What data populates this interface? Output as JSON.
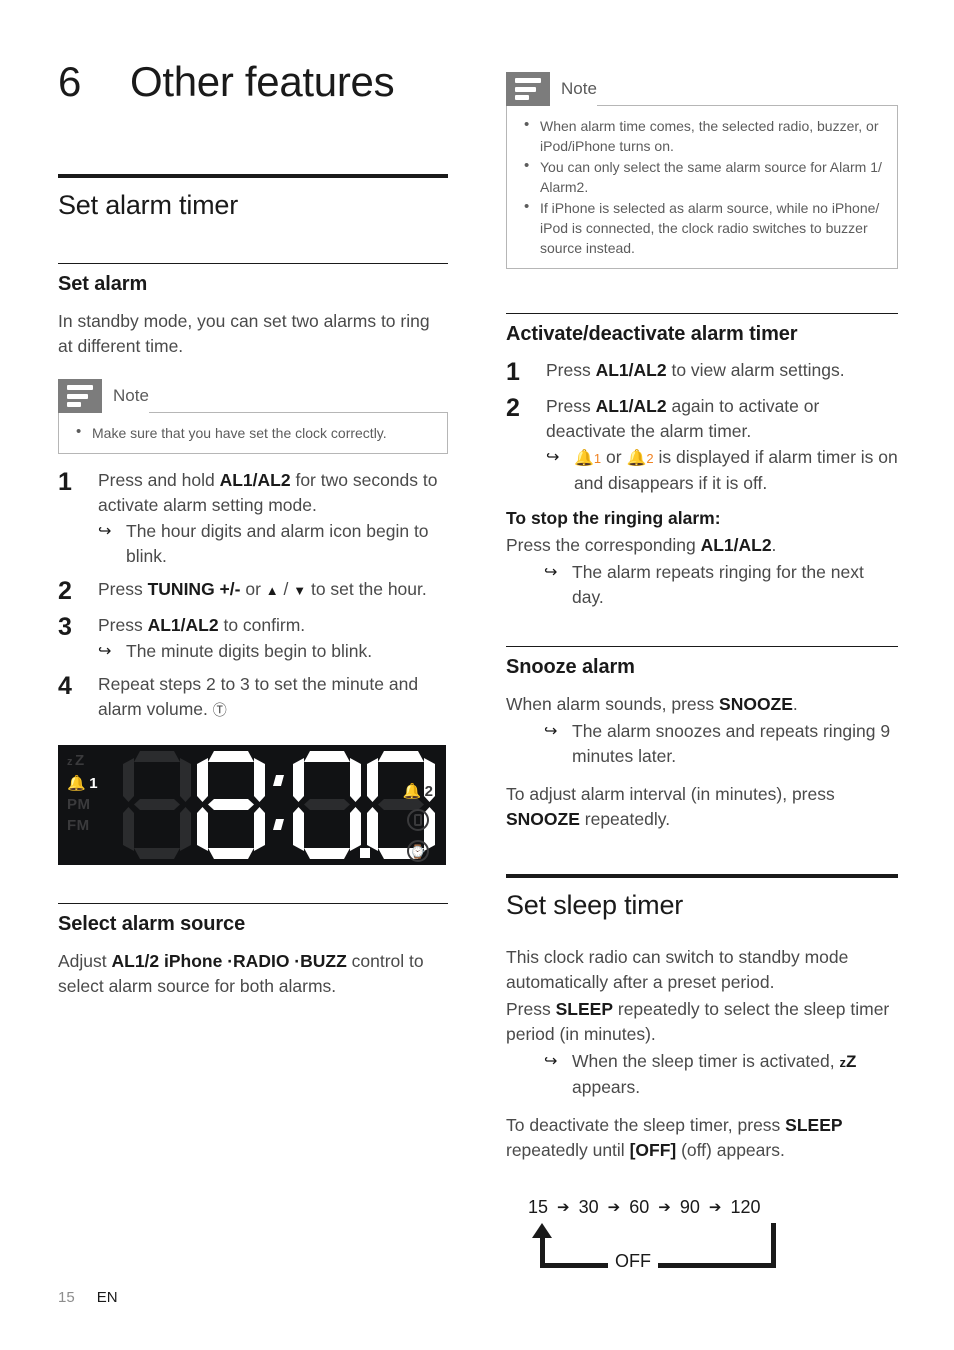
{
  "chapter": {
    "number": "6",
    "title": "Other features"
  },
  "footer": {
    "page": "15",
    "language": "EN"
  },
  "left": {
    "section_title": "Set alarm timer",
    "set_alarm": {
      "heading": "Set alarm",
      "intro": "In standby mode, you can set two alarms to ring at different time.",
      "note": {
        "label": "Note",
        "items": [
          "Make sure that you have set the clock correctly."
        ]
      },
      "steps": [
        {
          "num": "1",
          "text_before": "Press and hold ",
          "bold": "AL1/AL2",
          "text_after": " for two seconds to activate alarm setting mode.",
          "result": "The hour digits and alarm icon begin to blink."
        },
        {
          "num": "2",
          "text_before": "Press ",
          "bold": "TUNING +/-",
          "text_mid": " or ",
          "text_after": " to set the hour.",
          "result": ""
        },
        {
          "num": "3",
          "text_before": "Press ",
          "bold": "AL1/AL2",
          "text_after": " to confirm.",
          "result": "The minute digits begin to blink."
        },
        {
          "num": "4",
          "text_before": "Repeat steps 2 to 3 to set the minute and alarm volume. ",
          "bold": "",
          "text_after": "",
          "result": ""
        }
      ]
    },
    "lcd": {
      "indicators_left": [
        "zZ",
        "1",
        "PM",
        "FM"
      ],
      "indicators_right": [
        "2",
        "ipod-icon",
        "buzzer-icon"
      ],
      "digits": [
        "8",
        "8",
        "0",
        "0"
      ],
      "active_left_indicator": "alarm-1"
    },
    "select_source": {
      "heading": "Select alarm source",
      "text_before": "Adjust ",
      "bold": "AL1/2 iPhone ·RADIO ·BUZZ",
      "text_after": " control to select alarm source for both alarms."
    }
  },
  "right": {
    "note": {
      "label": "Note",
      "items": [
        "When alarm time comes, the selected radio, buzzer, or iPod/iPhone turns on.",
        "You can only select the same alarm source for Alarm 1/ Alarm2.",
        "If iPhone is selected as alarm source, while no iPhone/ iPod is connected, the clock radio switches to buzzer source instead."
      ]
    },
    "activate": {
      "heading": "Activate/deactivate alarm timer",
      "steps": [
        {
          "num": "1",
          "text_before": "Press ",
          "bold": "AL1/AL2",
          "text_after": " to view alarm settings.",
          "result": ""
        },
        {
          "num": "2",
          "text_before": "Press ",
          "bold": "AL1/AL2",
          "text_after": " again to activate or deactivate the alarm timer.",
          "result_before": " or ",
          "result_after": " is displayed if alarm timer is on and disappears if it is off.",
          "bell_1_label": "1",
          "bell_2_label": "2"
        }
      ],
      "stop_heading": "To stop the ringing alarm:",
      "stop_text_before": "Press the corresponding ",
      "stop_bold": "AL1/AL2",
      "stop_text_after": ".",
      "stop_result": "The alarm repeats ringing for the next day."
    },
    "snooze": {
      "heading": "Snooze alarm",
      "text_before": "When alarm sounds, press ",
      "bold": "SNOOZE",
      "text_after": ".",
      "result": "The alarm snoozes and repeats ringing 9 minutes later.",
      "adjust_before": "To adjust alarm interval (in minutes), press ",
      "adjust_bold": "SNOOZE",
      "adjust_after": " repeatedly."
    },
    "sleep": {
      "section_title": "Set sleep timer",
      "intro": "This clock radio can switch to standby mode automatically after a preset period.",
      "press_before": "Press ",
      "press_bold": "SLEEP",
      "press_after": " repeatedly to select the sleep timer period (in minutes).",
      "result_before": "When the sleep timer is activated, ",
      "result_after": " appears.",
      "deactivate_before": "To deactivate the sleep timer, press ",
      "deactivate_bold1": "SLEEP",
      "deactivate_mid": " repeatedly until ",
      "deactivate_bold2": "[OFF]",
      "deactivate_after": " (off) appears.",
      "flow": {
        "values": [
          "15",
          "30",
          "60",
          "90",
          "120"
        ],
        "arrow": "➔",
        "off_label": "OFF"
      }
    }
  }
}
